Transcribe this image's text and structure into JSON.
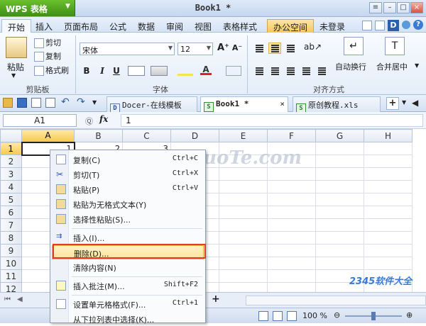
{
  "app": {
    "name": "WPS 表格",
    "doc_title": "Book1 *"
  },
  "ribbon_tabs": [
    "开始",
    "插入",
    "页面布局",
    "公式",
    "数据",
    "审阅",
    "视图",
    "表格样式",
    "办公空间"
  ],
  "ribbon_right": {
    "login": "未登录",
    "help": "?"
  },
  "clipboard": {
    "paste": "粘贴",
    "cut": "剪切",
    "copy": "复制",
    "format_painter": "格式刷",
    "group": "剪贴板"
  },
  "font": {
    "name": "宋体",
    "size": "12",
    "group": "字体",
    "bold": "B",
    "italic": "I",
    "underline": "U"
  },
  "alignment": {
    "group": "对齐方式",
    "wrap": "自动换行",
    "merge": "合并居中"
  },
  "doc_tabs": [
    {
      "label": "Docer-在线模板",
      "icon": "D"
    },
    {
      "label": "Book1 *",
      "icon": "S"
    },
    {
      "label": "原创教程.xls",
      "icon": "S"
    }
  ],
  "formula": {
    "namebox": "A1",
    "value": "1",
    "fx": "fx"
  },
  "columns": [
    "A",
    "B",
    "C",
    "D",
    "E",
    "F",
    "G",
    "H"
  ],
  "rows": [
    "1",
    "2",
    "3",
    "4",
    "5",
    "6",
    "7",
    "8",
    "9",
    "10",
    "11",
    "12"
  ],
  "cells": {
    "A1": "1",
    "B1": "2",
    "C1": "3"
  },
  "context_menu": [
    {
      "label": "复制(C)",
      "shortcut": "Ctrl+C",
      "icon": "copy-icon"
    },
    {
      "label": "剪切(T)",
      "shortcut": "Ctrl+X",
      "icon": "scissors-icon"
    },
    {
      "label": "粘贴(P)",
      "shortcut": "Ctrl+V",
      "icon": "paste-icon"
    },
    {
      "label": "粘贴为无格式文本(Y)",
      "shortcut": "",
      "icon": "paste-text-icon"
    },
    {
      "label": "选择性粘贴(S)...",
      "shortcut": "",
      "icon": "paste-special-icon"
    },
    {
      "label": "插入(I)...",
      "shortcut": "",
      "icon": "insert-icon"
    },
    {
      "label": "删除(D)...",
      "shortcut": "",
      "icon": ""
    },
    {
      "label": "清除内容(N)",
      "shortcut": "",
      "icon": ""
    },
    {
      "label": "插入批注(M)...",
      "shortcut": "Shift+F2",
      "icon": "comment-icon"
    },
    {
      "label": "设置单元格格式(F)...",
      "shortcut": "Ctrl+1",
      "icon": "format-cells-icon"
    },
    {
      "label": "从下拉列表中选择(K)...",
      "shortcut": "",
      "icon": ""
    }
  ],
  "status": {
    "zoom": "100 %"
  },
  "watermark": "www.DuoTe.com",
  "logo": "2345软件大全"
}
